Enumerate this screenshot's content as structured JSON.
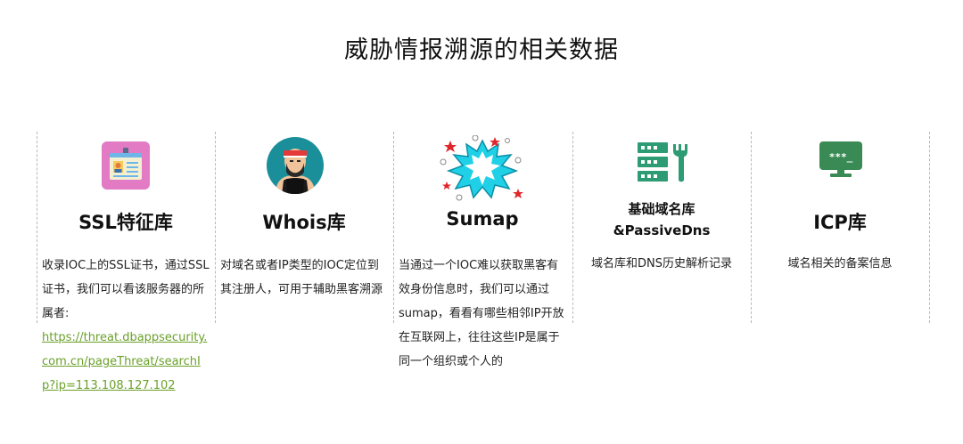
{
  "page": {
    "title": "威胁情报溯源的相关数据"
  },
  "columns": [
    {
      "icon": "id-card-icon",
      "title": "SSL特征库",
      "desc": "收录IOC上的SSL证书，通过SSL证书，我们可以看该服务器的所属者:",
      "link": "https://threat.dbappsecurity.com.cn/pageThreat/searchIp?ip=113.108.127.102"
    },
    {
      "icon": "person-headband-icon",
      "title": "Whois库",
      "desc": "对域名或者IP类型的IOC定位到其注册人，可用于辅助黑客溯源"
    },
    {
      "icon": "explosion-icon",
      "title": "Sumap",
      "desc": "当通过一个IOC难以获取黑客有效身份信息时，我们可以通过sumap，看看有哪些相邻IP开放在互联网上，往往这些IP是属于同一个组织或个人的"
    },
    {
      "icon": "server-wrench-icon",
      "title_line1": "基础域名库",
      "title_line2": "&PassiveDns",
      "desc": "域名库和DNS历史解析记录"
    },
    {
      "icon": "monitor-password-icon",
      "title": "ICP库",
      "desc": "域名相关的备案信息",
      "screen_text": "***_"
    }
  ],
  "colors": {
    "link": "#6aa02a",
    "server_green": "#2d9b73",
    "icp_green": "#3a8a55",
    "explosion_cyan": "#1fd0e6",
    "star_red": "#e0262b",
    "card_pink": "#e27ac4",
    "whois_teal": "#1a8f9a"
  }
}
